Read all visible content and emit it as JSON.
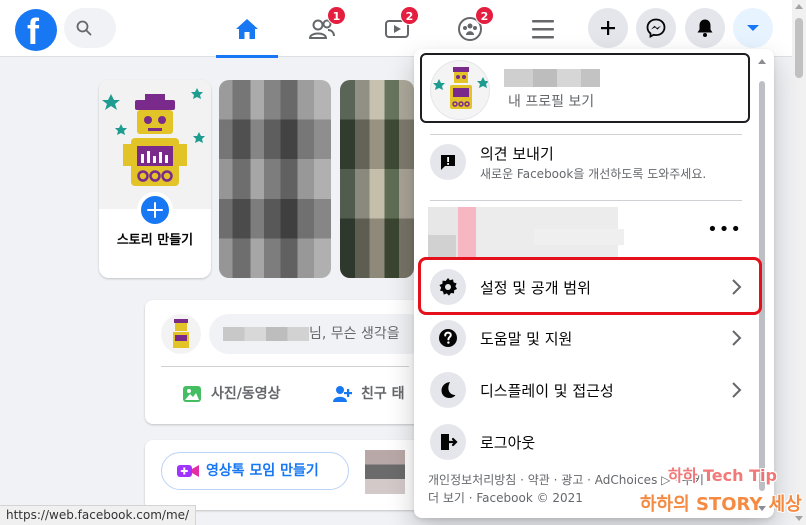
{
  "nav": {
    "friends_badge": "1",
    "watch_badge": "2",
    "groups_badge": "2"
  },
  "stories": {
    "create_label": "스토리 만들기"
  },
  "composer": {
    "placeholder_suffix": "님, 무슨 생각을",
    "photo_video": "사진/동영상",
    "tag_friends": "친구 태"
  },
  "rooms": {
    "create_room": "영상톡 모임 만들기"
  },
  "menu": {
    "profile_subtitle": "내 프로필 보기",
    "feedback_title": "의견 보내기",
    "feedback_subtitle": "새로운 Facebook을 개선하도록 도와주세요.",
    "more_dots": "•••",
    "settings": "설정 및 공개 범위",
    "help": "도움말 및 지원",
    "display": "디스플레이 및 접근성",
    "logout": "로그아웃",
    "footer_line1": "개인정보처리방침 · 약관 · 광고 · AdChoices ▷ · 쿠키 ·",
    "footer_line2": "더 보기 · Facebook © 2021"
  },
  "status_url": "https://web.facebook.com/me/",
  "watermark": {
    "line1": "하하 Tech Tip",
    "line2": "하하의 STORY 세상"
  },
  "colors": {
    "brand": "#1877f2",
    "badge": "#e41e3f",
    "highlight": "#e4101c"
  }
}
